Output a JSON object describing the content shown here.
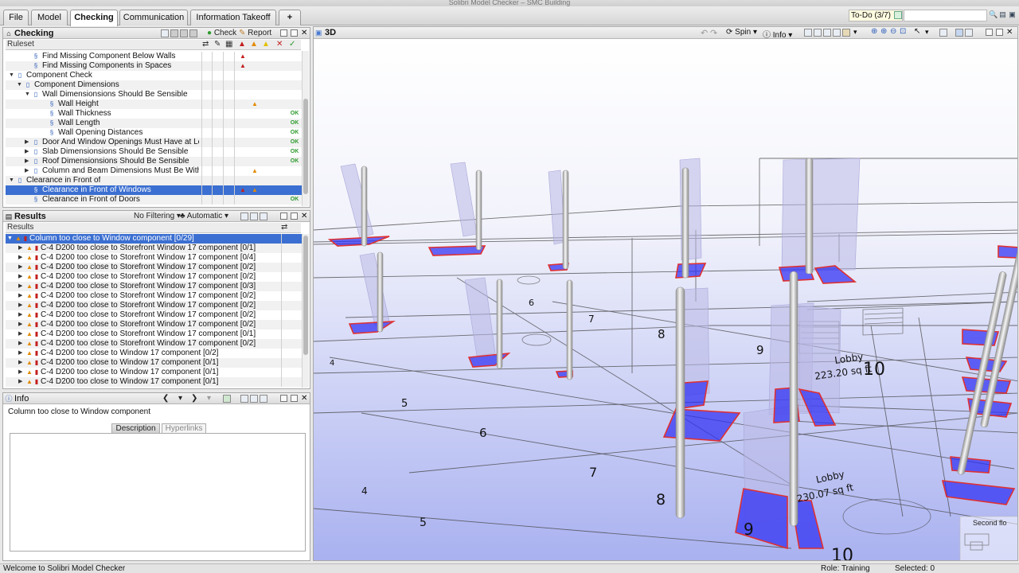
{
  "window": {
    "title": "Solibri Model Checker – SMC Building"
  },
  "tabs": [
    {
      "label": "File"
    },
    {
      "label": "Model"
    },
    {
      "label": "Checking"
    },
    {
      "label": "Communication"
    },
    {
      "label": "Information Takeoff"
    },
    {
      "label": "+"
    }
  ],
  "todo": {
    "label": "To-Do (3/7)"
  },
  "checking_panel": {
    "title": "Checking",
    "check_label": "Check",
    "report_label": "Report",
    "column_header": "Ruleset",
    "rows": [
      {
        "label": "Find Missing Component Below Walls",
        "indent": 3,
        "arrow": "",
        "icon": "§",
        "marks": [
          "red",
          "",
          "",
          "",
          ""
        ]
      },
      {
        "label": "Find Missing Components in Spaces",
        "indent": 3,
        "arrow": "",
        "icon": "§",
        "marks": [
          "red",
          "",
          "",
          "",
          ""
        ]
      },
      {
        "label": "Component Check",
        "indent": 1,
        "arrow": "▼",
        "icon": "▯",
        "marks": [
          "",
          "",
          "",
          "",
          ""
        ]
      },
      {
        "label": "Component Dimensions",
        "indent": 2,
        "arrow": "▼",
        "icon": "▯",
        "marks": [
          "",
          "",
          "",
          "",
          ""
        ]
      },
      {
        "label": "Wall Dimensionsions Should Be Sensible",
        "indent": 3,
        "arrow": "▼",
        "icon": "▯",
        "marks": [
          "",
          "",
          "",
          "",
          ""
        ]
      },
      {
        "label": "Wall Height",
        "indent": 5,
        "arrow": "",
        "icon": "§",
        "marks": [
          "",
          "orange",
          "",
          "",
          ""
        ]
      },
      {
        "label": "Wall Thickness",
        "indent": 5,
        "arrow": "",
        "icon": "§",
        "marks": [
          "",
          "",
          "",
          "",
          "OK"
        ]
      },
      {
        "label": "Wall Length",
        "indent": 5,
        "arrow": "",
        "icon": "§",
        "marks": [
          "",
          "",
          "",
          "",
          "OK"
        ]
      },
      {
        "label": "Wall Opening Distances",
        "indent": 5,
        "arrow": "",
        "icon": "§",
        "marks": [
          "",
          "",
          "",
          "",
          "OK"
        ]
      },
      {
        "label": "Door And Window Openings Must Have at Lea:",
        "indent": 3,
        "arrow": "▶",
        "icon": "▯",
        "marks": [
          "",
          "",
          "",
          "",
          "OK"
        ]
      },
      {
        "label": "Slab Dimensionsions Should Be Sensible",
        "indent": 3,
        "arrow": "▶",
        "icon": "▯",
        "marks": [
          "",
          "",
          "",
          "",
          "OK"
        ]
      },
      {
        "label": "Roof Dimensionsions Should Be Sensible",
        "indent": 3,
        "arrow": "▶",
        "icon": "▯",
        "marks": [
          "",
          "",
          "",
          "",
          "OK"
        ]
      },
      {
        "label": "Column and Beam Dimensions Must Be Within",
        "indent": 3,
        "arrow": "▶",
        "icon": "▯",
        "marks": [
          "",
          "orange",
          "",
          "",
          ""
        ]
      },
      {
        "label": "Clearance  in Front of",
        "indent": 1,
        "arrow": "▼",
        "icon": "▯",
        "marks": [
          "",
          "",
          "",
          "",
          ""
        ]
      },
      {
        "label": "Clearance in Front of Windows",
        "indent": 3,
        "arrow": "",
        "icon": "§",
        "marks": [
          "red",
          "orange",
          "",
          "",
          ""
        ],
        "selected": true
      },
      {
        "label": "Clearance in Front of Doors",
        "indent": 3,
        "arrow": "",
        "icon": "§",
        "marks": [
          "",
          "",
          "",
          "",
          "OK"
        ]
      }
    ]
  },
  "results_panel": {
    "title": "Results",
    "filter_label": "No Filtering",
    "mode_label": "Automatic",
    "column_header": "Results",
    "rows": [
      {
        "label": "Column too close to Window component [0/29]",
        "selected": true,
        "top": true
      },
      {
        "label": "C-4 D200 too close to Storefront Window 17 component [0/1]"
      },
      {
        "label": "C-4 D200 too close to Storefront Window 17 component [0/4]"
      },
      {
        "label": "C-4 D200 too close to Storefront Window 17 component [0/2]"
      },
      {
        "label": "C-4 D200 too close to Storefront Window 17 component [0/2]"
      },
      {
        "label": "C-4 D200 too close to Storefront Window 17 component [0/3]"
      },
      {
        "label": "C-4 D200 too close to Storefront Window 17 component [0/2]"
      },
      {
        "label": "C-4 D200 too close to Storefront Window 17 component [0/2]"
      },
      {
        "label": "C-4 D200 too close to Storefront Window 17 component [0/2]"
      },
      {
        "label": "C-4 D200 too close to Storefront Window 17 component [0/2]"
      },
      {
        "label": "C-4 D200 too close to Storefront Window 17 component [0/1]"
      },
      {
        "label": "C-4 D200 too close to Storefront Window 17 component [0/2]"
      },
      {
        "label": "C-4 D200 too close to Window 17 component [0/2]"
      },
      {
        "label": "C-4 D200 too close to Window 17 component [0/1]"
      },
      {
        "label": "C-4 D200 too close to Window 17 component [0/1]"
      },
      {
        "label": "C-4 D200 too close to Window 17 component [0/1]"
      }
    ]
  },
  "info_panel": {
    "title": "Info",
    "text": "Column too close to Window component",
    "tabs": [
      "Description",
      "Hyperlinks"
    ]
  },
  "view3d": {
    "title": "3D",
    "spin_label": "Spin",
    "info_label": "Info",
    "labels": {
      "lobby1": "Lobby",
      "lobby1_area": "223.20 sq ft",
      "lobby2": "Lobby",
      "lobby2_area": "230.07 sq ft",
      "second_floor": "Second flo",
      "n10a": "10",
      "n10b": "10",
      "n9a": "9",
      "n9b": "9",
      "n8a": "8",
      "n8b": "8",
      "n7a": "7",
      "n7b": "7",
      "n6a": "6",
      "n6b": "6",
      "n5a": "5",
      "n5b": "5",
      "n4a": "4",
      "n4b": "4"
    }
  },
  "status": {
    "message": "Welcome to Solibri Model Checker",
    "role": "Role: Training",
    "selected": "Selected: 0"
  },
  "colors": {
    "selection": "#3b6fd1",
    "error": "#c31e1e",
    "warning": "#e28a00",
    "ok": "#2c9a2c"
  }
}
